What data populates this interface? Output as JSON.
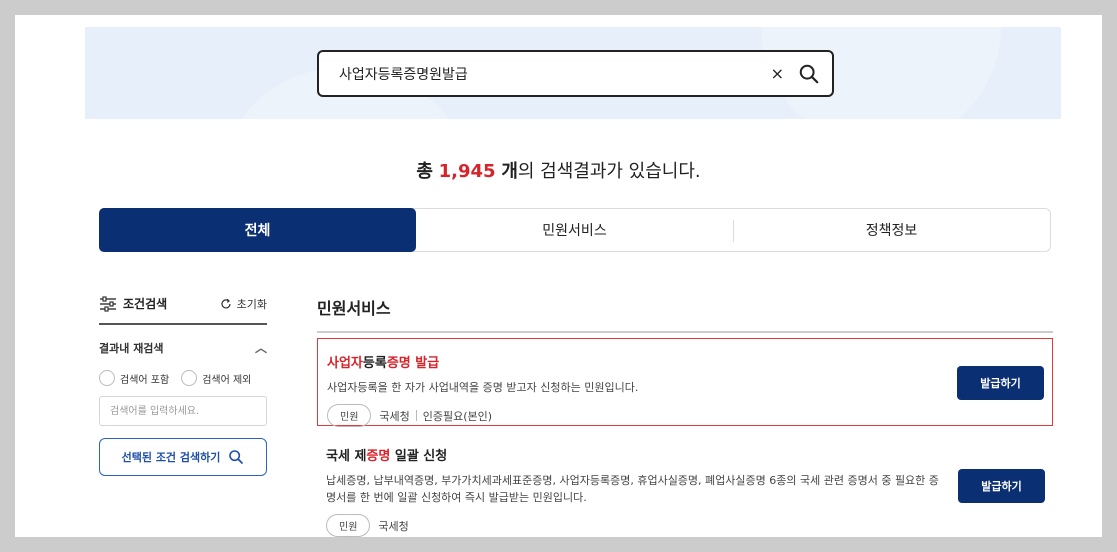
{
  "search": {
    "query": "사업자등록증명원발급",
    "clear_symbol": "×"
  },
  "summary": {
    "prefix": "총",
    "count": "1,945",
    "unit": "개",
    "suffix": "의 검색결과가 있습니다."
  },
  "tabs": [
    {
      "label": "전체",
      "active": true
    },
    {
      "label": "민원서비스",
      "active": false
    },
    {
      "label": "정책정보",
      "active": false
    }
  ],
  "sidebar": {
    "title": "조건검색",
    "reset_label": "초기화",
    "subsection_title": "결과내 재검색",
    "chevron": "︿",
    "options": [
      "검색어 포함",
      "검색어 제외"
    ],
    "input_placeholder": "검색어를 입력하세요.",
    "apply_label": "선택된 조건 검색하기"
  },
  "main": {
    "section_title": "민원서비스",
    "results": [
      {
        "title_parts": [
          "사업자",
          "등록",
          "증명 발급"
        ],
        "description": "사업자등록을 한 자가 사업내역을 증명 받고자 신청하는 민원입니다.",
        "tag": "민원",
        "agency": "국세청",
        "auth": "인증필요(본인)",
        "button": "발급하기"
      },
      {
        "title_parts": [
          "국세 제",
          "증명",
          " 일괄 신청"
        ],
        "description": "납세증명, 납부내역증명, 부가가치세과세표준증명, 사업자등록증명, 휴업사실증명, 폐업사실증명 6종의 국세 관련 증명서 중 필요한 증명서를 한 번에 일괄 신청하여 즉시 발급받는 민원입니다.",
        "tag": "민원",
        "agency": "국세청",
        "button": "발급하기"
      }
    ]
  },
  "colors": {
    "navy": "#0b2f73",
    "highlight_red": "#d8232a",
    "hero_bg": "#e6effa"
  }
}
